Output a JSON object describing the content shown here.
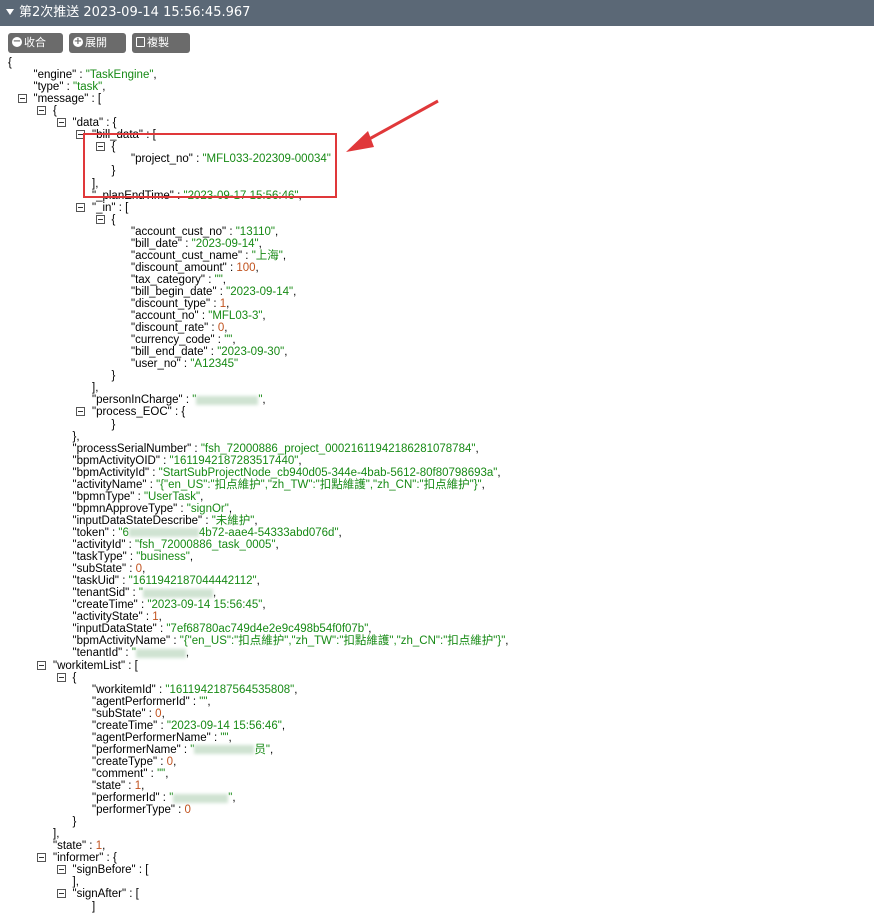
{
  "header": {
    "title": "第2次推送 2023-09-14 15:56:45.967"
  },
  "toolbar": {
    "collapse": "收合",
    "expand": "展開",
    "copy": "複製"
  },
  "json_lines": [
    {
      "i": 0,
      "t": "{"
    },
    {
      "i": 1,
      "k": "\"engine\"",
      "v": "\"TaskEngine\"",
      "vt": "s",
      "e": ","
    },
    {
      "i": 1,
      "k": "\"type\"",
      "v": "\"task\"",
      "vt": "s",
      "e": ","
    },
    {
      "i": 1,
      "k": "\"message\"",
      "t2": "[",
      "tog": true
    },
    {
      "i": 2,
      "t": "{",
      "tog": true
    },
    {
      "i": 3,
      "k": "\"data\"",
      "t2": "{",
      "tog": true
    },
    {
      "i": 4,
      "k": "\"bill_data\"",
      "t2": "[",
      "tog": true
    },
    {
      "i": 5,
      "t": "{",
      "tog": true
    },
    {
      "i": 6,
      "k": "\"project_no\"",
      "v": "\"MFL033-202309-00034\"",
      "vt": "s"
    },
    {
      "i": 5,
      "t": "}"
    },
    {
      "i": 4,
      "t": "],"
    },
    {
      "i": 4,
      "k": "\"_planEndTime\"",
      "v": "\"2023-09-17 15:56:46\"",
      "vt": "s",
      "e": ","
    },
    {
      "i": 4,
      "k": "\"_in\"",
      "t2": "[",
      "tog": true
    },
    {
      "i": 5,
      "t": "{",
      "tog": true
    },
    {
      "i": 6,
      "k": "\"account_cust_no\"",
      "v": "\"13110\"",
      "vt": "s",
      "e": ","
    },
    {
      "i": 6,
      "k": "\"bill_date\"",
      "v": "\"2023-09-14\"",
      "vt": "s",
      "e": ","
    },
    {
      "i": 6,
      "k": "\"account_cust_name\"",
      "v": "\"上海\"",
      "vt": "s",
      "e": ","
    },
    {
      "i": 6,
      "k": "\"discount_amount\"",
      "v": "100",
      "vt": "n",
      "e": ","
    },
    {
      "i": 6,
      "k": "\"tax_category\"",
      "v": "\"\"",
      "vt": "s",
      "e": ","
    },
    {
      "i": 6,
      "k": "\"bill_begin_date\"",
      "v": "\"2023-09-14\"",
      "vt": "s",
      "e": ","
    },
    {
      "i": 6,
      "k": "\"discount_type\"",
      "v": "1",
      "vt": "n",
      "e": ","
    },
    {
      "i": 6,
      "k": "\"account_no\"",
      "v": "\"MFL03-3\"",
      "vt": "s",
      "e": ","
    },
    {
      "i": 6,
      "k": "\"discount_rate\"",
      "v": "0",
      "vt": "n",
      "e": ","
    },
    {
      "i": 6,
      "k": "\"currency_code\"",
      "v": "\"\"",
      "vt": "s",
      "e": ","
    },
    {
      "i": 6,
      "k": "\"bill_end_date\"",
      "v": "\"2023-09-30\"",
      "vt": "s",
      "e": ","
    },
    {
      "i": 6,
      "k": "\"user_no\"",
      "v": "\"A12345\"",
      "vt": "s"
    },
    {
      "i": 5,
      "t": "}"
    },
    {
      "i": 4,
      "t": "],"
    },
    {
      "i": 4,
      "k": "\"personInCharge\"",
      "v": "\"",
      "vt": "s",
      "blur": 62,
      "v2": "\"",
      "e": ","
    },
    {
      "i": 4,
      "k": "\"process_EOC\"",
      "t2": "{",
      "tog": true
    },
    {
      "i": 5,
      "t": "}"
    },
    {
      "i": 3,
      "t": "},"
    },
    {
      "i": 3,
      "k": "\"processSerialNumber\"",
      "v": "\"fsh_72000886_project_0002161194218628107878​4\"",
      "vt": "s",
      "e": ","
    },
    {
      "i": 3,
      "k": "\"bpmActivityOID\"",
      "v": "\"1611942187283517440\"",
      "vt": "s",
      "e": ","
    },
    {
      "i": 3,
      "k": "\"bpmActivityId\"",
      "v": "\"StartSubProjectNode_cb940d05-344e-4bab-5612-80f80798693a\"",
      "vt": "s",
      "e": ","
    },
    {
      "i": 3,
      "k": "\"activityName\"",
      "v": "\"{\"en_US\":\"扣点維护\",\"zh_TW\":\"扣點維護\",\"zh_CN\":\"扣点維护\"}\"",
      "vt": "s",
      "e": ","
    },
    {
      "i": 3,
      "k": "\"bpmnType\"",
      "v": "\"UserTask\"",
      "vt": "s",
      "e": ","
    },
    {
      "i": 3,
      "k": "\"bpmnApproveType\"",
      "v": "\"signOr\"",
      "vt": "s",
      "e": ","
    },
    {
      "i": 3,
      "k": "\"inputDataStateDescribe\"",
      "v": "\"未維护\"",
      "vt": "s",
      "e": ","
    },
    {
      "i": 3,
      "k": "\"token\"",
      "v": "\"6",
      "vt": "s",
      "blur": 70,
      "v2": "4b72-aae4-54333abd076d\"",
      "e": ","
    },
    {
      "i": 3,
      "k": "\"activityId\"",
      "v": "\"fsh_72000886_task_0005\"",
      "vt": "s",
      "e": ","
    },
    {
      "i": 3,
      "k": "\"taskType\"",
      "v": "\"business\"",
      "vt": "s",
      "e": ","
    },
    {
      "i": 3,
      "k": "\"subState\"",
      "v": "0",
      "vt": "n",
      "e": ","
    },
    {
      "i": 3,
      "k": "\"taskUid\"",
      "v": "\"1611942187044442112\"",
      "vt": "s",
      "e": ","
    },
    {
      "i": 3,
      "k": "\"tenantSid\"",
      "v": "\"",
      "vt": "s",
      "blur": 70,
      "v2": "",
      "e": ","
    },
    {
      "i": 3,
      "k": "\"createTime\"",
      "v": "\"2023-09-14 15:56:45\"",
      "vt": "s",
      "e": ","
    },
    {
      "i": 3,
      "k": "\"activityState\"",
      "v": "1",
      "vt": "n",
      "e": ","
    },
    {
      "i": 3,
      "k": "\"inputDataState\"",
      "v": "\"7ef68780ac749d4e2e9c498b54f0f07b\"",
      "vt": "s",
      "e": ","
    },
    {
      "i": 3,
      "k": "\"bpmActivityName\"",
      "v": "\"{\"en_US\":\"扣点維护\",\"zh_TW\":\"扣點維護\",\"zh_CN\":\"扣点維护\"}\"",
      "vt": "s",
      "e": ","
    },
    {
      "i": 3,
      "k": "\"tenantId\"",
      "v": "\"",
      "vt": "s",
      "blur": 50,
      "v2": "",
      "e": ","
    },
    {
      "i": 2,
      "k": "\"workitemList\"",
      "t2": "[",
      "tog": true
    },
    {
      "i": 3,
      "t": "{",
      "tog": true
    },
    {
      "i": 4,
      "k": "\"workitemId\"",
      "v": "\"1611942187564535808\"",
      "vt": "s",
      "e": ","
    },
    {
      "i": 4,
      "k": "\"agentPerformerId\"",
      "v": "\"\"",
      "vt": "s",
      "e": ","
    },
    {
      "i": 4,
      "k": "\"subState\"",
      "v": "0",
      "vt": "n",
      "e": ","
    },
    {
      "i": 4,
      "k": "\"createTime\"",
      "v": "\"2023-09-14 15:56:46\"",
      "vt": "s",
      "e": ","
    },
    {
      "i": 4,
      "k": "\"agentPerformerName\"",
      "v": "\"\"",
      "vt": "s",
      "e": ","
    },
    {
      "i": 4,
      "k": "\"performerName\"",
      "v": "\"",
      "vt": "s",
      "blur": 60,
      "v2": "员\"",
      "e": ","
    },
    {
      "i": 4,
      "k": "\"createType\"",
      "v": "0",
      "vt": "n",
      "e": ","
    },
    {
      "i": 4,
      "k": "\"comment\"",
      "v": "\"\"",
      "vt": "s",
      "e": ","
    },
    {
      "i": 4,
      "k": "\"state\"",
      "v": "1",
      "vt": "n",
      "e": ","
    },
    {
      "i": 4,
      "k": "\"performerId\"",
      "v": "\"",
      "vt": "s",
      "blur": 55,
      "v2": "\"",
      "e": ","
    },
    {
      "i": 4,
      "k": "\"performerType\"",
      "v": "0",
      "vt": "n"
    },
    {
      "i": 3,
      "t": "}"
    },
    {
      "i": 2,
      "t": "],"
    },
    {
      "i": 2,
      "k": "\"state\"",
      "v": "1",
      "vt": "n",
      "e": ","
    },
    {
      "i": 2,
      "k": "\"informer\"",
      "t2": "{",
      "tog": true
    },
    {
      "i": 3,
      "k": "\"signBefore\"",
      "t2": "[",
      "tog": true
    },
    {
      "i": 3,
      "t": "],"
    },
    {
      "i": 3,
      "k": "\"signAfter\"",
      "t2": "[",
      "tog": true
    },
    {
      "i": 4,
      "t": "]"
    }
  ],
  "colors": {
    "header_bg": "#5b6876",
    "string": "#178a15",
    "number": "#c1531f",
    "annotation": "#e0383a"
  }
}
